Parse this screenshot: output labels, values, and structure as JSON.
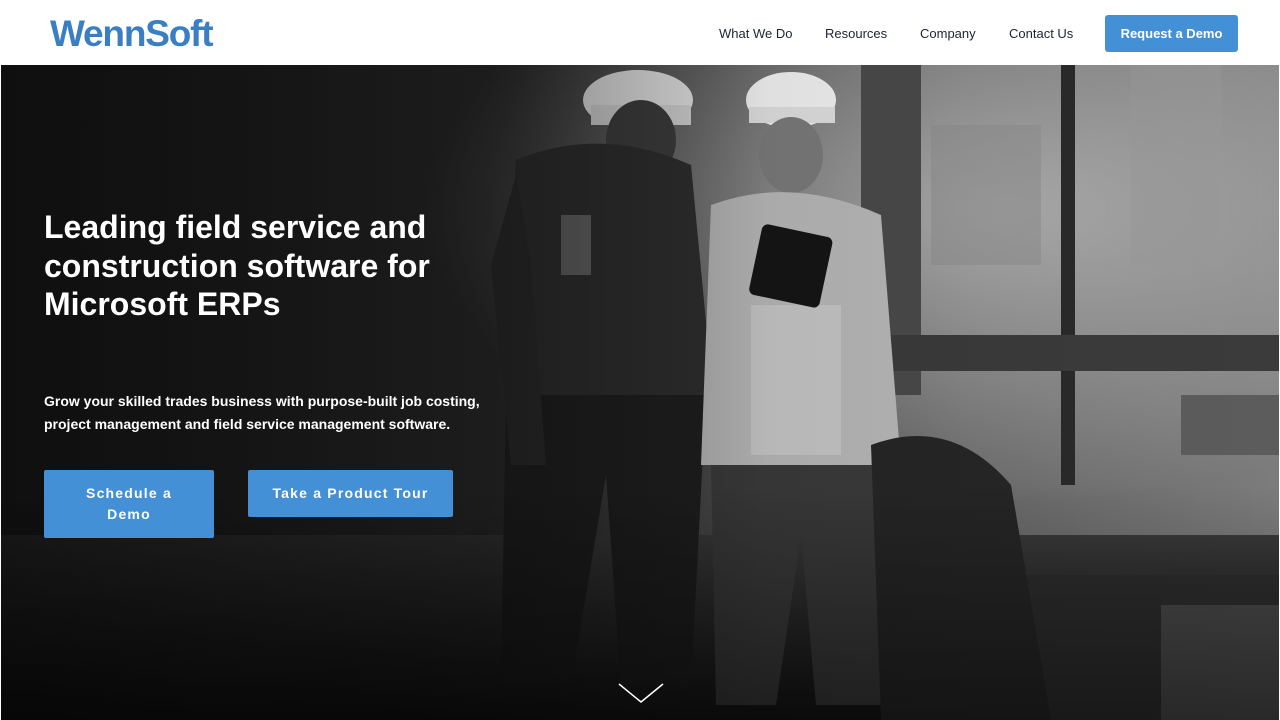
{
  "header": {
    "logo_text": "WennSoft",
    "nav": {
      "what_we_do": "What We Do",
      "resources": "Resources",
      "company": "Company",
      "contact_us": "Contact Us"
    },
    "cta_label": "Request a Demo"
  },
  "hero": {
    "title": "Leading field service and construction software for Microsoft ERPs",
    "subtitle": "Grow your skilled trades business with purpose-built job costing, project management and field service management software.",
    "buttons": {
      "schedule": "Schedule a Demo",
      "tour": "Take a Product Tour"
    },
    "scroll_icon": "chevron-down-icon"
  },
  "colors": {
    "brand_blue": "#3a7fc4",
    "button_blue": "#4390d6",
    "nav_text": "#1d2330",
    "hero_text": "#ffffff"
  }
}
